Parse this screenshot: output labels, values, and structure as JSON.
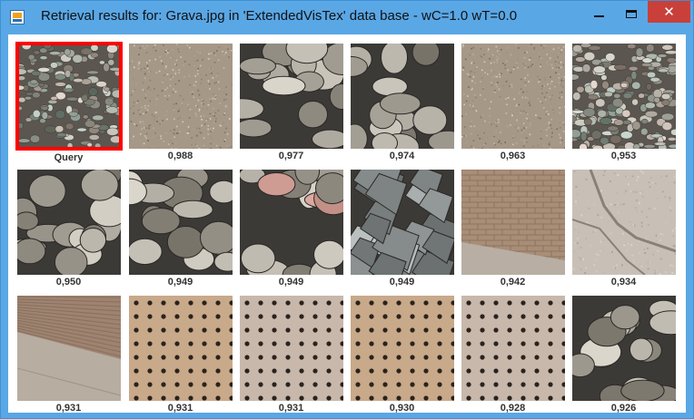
{
  "window": {
    "title": "Retrieval results for: Grava.jpg in 'ExtendedVisTex' data base - wC=1.0 wT=0.0"
  },
  "colors": {
    "title_bar": "#5aa7e6",
    "close_button": "#c9403a",
    "query_border": "#ff0000"
  },
  "results": [
    {
      "label": "Query",
      "icon": "pebbles-small"
    },
    {
      "label": "0,988",
      "icon": "sand"
    },
    {
      "label": "0,977",
      "icon": "stones-large"
    },
    {
      "label": "0,974",
      "icon": "stones-large"
    },
    {
      "label": "0,963",
      "icon": "sand"
    },
    {
      "label": "0,953",
      "icon": "gravel"
    },
    {
      "label": "0,950",
      "icon": "stones-large"
    },
    {
      "label": "0,949",
      "icon": "stones-large"
    },
    {
      "label": "0,949",
      "icon": "stones-mixed"
    },
    {
      "label": "0,949",
      "icon": "rocks-grey"
    },
    {
      "label": "0,942",
      "icon": "brick-wall"
    },
    {
      "label": "0,934",
      "icon": "concrete-wall"
    },
    {
      "label": "0,931",
      "icon": "brick-wall-perspective"
    },
    {
      "label": "0,931",
      "icon": "perforated-tan"
    },
    {
      "label": "0,931",
      "icon": "perforated-grey"
    },
    {
      "label": "0,930",
      "icon": "perforated-tan"
    },
    {
      "label": "0,928",
      "icon": "perforated-grey"
    },
    {
      "label": "0,926",
      "icon": "stones-large"
    }
  ]
}
